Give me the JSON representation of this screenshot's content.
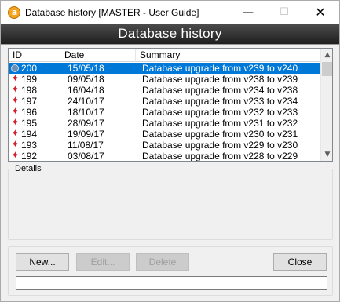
{
  "window": {
    "title": "Database history [MASTER - User Guide]",
    "app_icon_letter": "a",
    "minimize_glyph": "—",
    "maximize_glyph": "☐",
    "close_glyph": "✕"
  },
  "banner": {
    "title": "Database history"
  },
  "list": {
    "columns": {
      "id": "ID",
      "date": "Date",
      "summary": "Summary"
    },
    "rows": [
      {
        "id": "200",
        "date": "15/05/18",
        "summary": "Database upgrade from v239 to v240",
        "selected": true
      },
      {
        "id": "199",
        "date": "09/05/18",
        "summary": "Database upgrade from v238 to v239"
      },
      {
        "id": "198",
        "date": "16/04/18",
        "summary": "Database upgrade from v234 to v238"
      },
      {
        "id": "197",
        "date": "24/10/17",
        "summary": "Database upgrade from v233 to v234"
      },
      {
        "id": "196",
        "date": "18/10/17",
        "summary": "Database upgrade from v232 to v233"
      },
      {
        "id": "195",
        "date": "28/09/17",
        "summary": "Database upgrade from v231 to v232"
      },
      {
        "id": "194",
        "date": "19/09/17",
        "summary": "Database upgrade from v230 to v231"
      },
      {
        "id": "193",
        "date": "11/08/17",
        "summary": "Database upgrade from v229 to v230"
      },
      {
        "id": "192",
        "date": "03/08/17",
        "summary": "Database upgrade from v228 to v229"
      }
    ],
    "row_icon": "✦",
    "scroll_up_glyph": "▲",
    "scroll_down_glyph": "▼"
  },
  "details": {
    "label": "Details"
  },
  "buttons": {
    "new": "New...",
    "edit": "Edit...",
    "delete": "Delete",
    "close": "Close"
  },
  "colors": {
    "selection": "#0078d7",
    "row_icon": "#d4202b",
    "banner": "#2e2e2e",
    "app_icon": "#f3a31c"
  }
}
